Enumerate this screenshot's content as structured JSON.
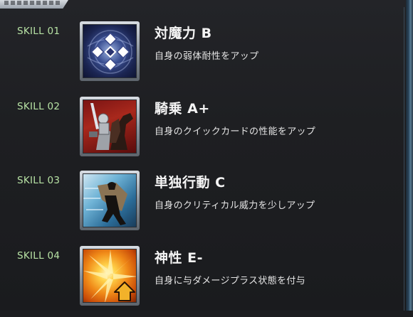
{
  "header": {
    "tab_label": ""
  },
  "skills": [
    {
      "number": "SKILL 01",
      "name": "対魔力 B",
      "description": "自身の弱体耐性をアップ",
      "icon": "magic-resistance-icon"
    },
    {
      "number": "SKILL 02",
      "name": "騎乗 A+",
      "description": "自身のクイックカードの性能をアップ",
      "icon": "riding-knight-icon"
    },
    {
      "number": "SKILL 03",
      "name": "単独行動 C",
      "description": "自身のクリティカル威力を少しアップ",
      "icon": "cloaked-figure-icon"
    },
    {
      "number": "SKILL 04",
      "name": "神性 E-",
      "description": "自身に与ダメージプラス状態を付与",
      "icon": "burst-damage-up-icon"
    }
  ],
  "colors": {
    "skill_number": "#b7e2a4",
    "text": "#f4f4f4",
    "background": "#1c1d20"
  }
}
